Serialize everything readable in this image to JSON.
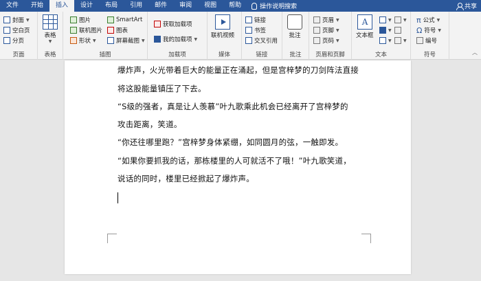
{
  "tabs": [
    "文件",
    "开始",
    "插入",
    "设计",
    "布局",
    "引用",
    "邮件",
    "审阅",
    "视图",
    "帮助"
  ],
  "active_tab": "插入",
  "tell_me": "操作说明搜索",
  "share": "共享",
  "ribbon": {
    "pages": {
      "label": "页面",
      "cover": "封面",
      "blank": "空白页",
      "break": "分页"
    },
    "tables": {
      "label": "表格",
      "table": "表格"
    },
    "illustrations": {
      "label": "插图",
      "pictures": "图片",
      "online_pictures": "联机图片",
      "shapes": "形状",
      "smartart": "SmartArt",
      "chart": "图表",
      "screenshot": "屏幕截图"
    },
    "addins": {
      "label": "加载项",
      "get": "获取加载项",
      "my": "我的加载项"
    },
    "media": {
      "label": "媒体",
      "online_video": "联机视频"
    },
    "links": {
      "label": "链接",
      "link": "链接",
      "bookmark": "书签",
      "crossref": "交叉引用"
    },
    "comments": {
      "label": "批注",
      "comment": "批注"
    },
    "header_footer": {
      "label": "页眉和页脚",
      "header": "页眉",
      "footer": "页脚",
      "page_number": "页码"
    },
    "text": {
      "label": "文本",
      "textbox": "文本框"
    },
    "symbols": {
      "label": "符号",
      "equation": "公式",
      "symbol": "符号",
      "number": "编号"
    }
  },
  "document": {
    "lines": [
      "爆炸声，火光带着巨大的能量正在涌起，但是宫梓梦的刀剑阵法直接",
      "将这股能量镇压了下去。",
      "“S级的强者，真是让人羡慕”叶九歌乘此机会已经离开了宫梓梦的",
      "攻击距离，笑道。",
      "“你还往哪里跑？”宫梓梦身体紧绷，如同圆月的弦，一触即发。",
      "“如果你要抓我的话，那栋楼里的人可就活不了哦！”叶九歌笑道，",
      "说话的同时，楼里已经掀起了爆炸声。"
    ]
  }
}
